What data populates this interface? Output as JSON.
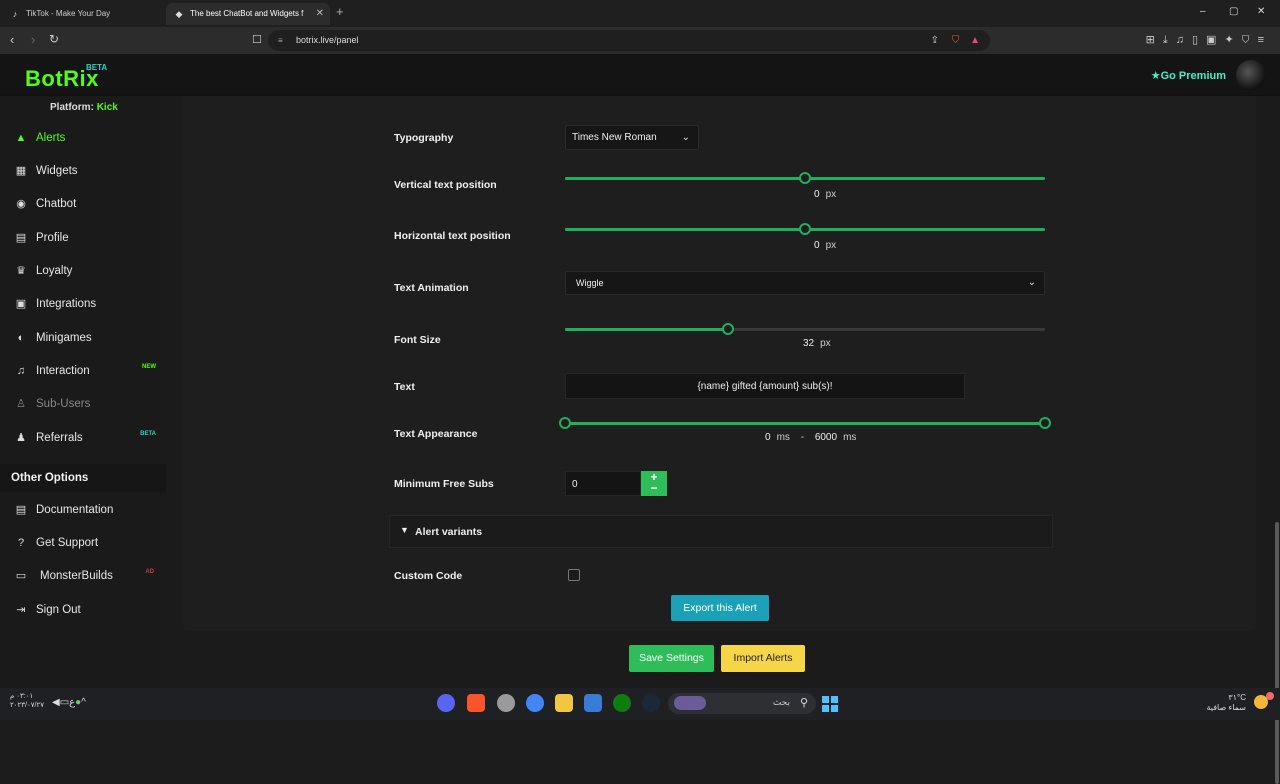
{
  "browser": {
    "tabs": [
      {
        "title": "TikTok - Make Your Day",
        "icon": "tiktok-icon"
      },
      {
        "title": "The best ChatBot and Widgets f",
        "icon": "botrix-icon"
      }
    ],
    "new_tab": "+",
    "url": "botrix.live/panel",
    "window_controls": {
      "minimize": "–",
      "maximize": "▢",
      "close": "✕"
    }
  },
  "header": {
    "logo": "BotRix",
    "beta": "BETA",
    "premium": "Go Premium"
  },
  "sidebar": {
    "platform_label": "Platform:",
    "platform_value": "Kick",
    "items": [
      {
        "label": "Alerts",
        "icon": "warning-icon",
        "glyph": "▲",
        "active": true
      },
      {
        "label": "Widgets",
        "icon": "widgets-icon",
        "glyph": "▦"
      },
      {
        "label": "Chatbot",
        "icon": "robot-icon",
        "glyph": "◉"
      },
      {
        "label": "Profile",
        "icon": "id-card-icon",
        "glyph": "▤"
      },
      {
        "label": "Loyalty",
        "icon": "trophy-icon",
        "glyph": "♛"
      },
      {
        "label": "Integrations",
        "icon": "integrations-icon",
        "glyph": "▣"
      },
      {
        "label": "Minigames",
        "icon": "gamepad-icon",
        "glyph": "◐"
      },
      {
        "label": "Interaction",
        "icon": "music-icon",
        "glyph": "♫",
        "badge": "NEW"
      },
      {
        "label": "Sub-Users",
        "icon": "sub-users-icon",
        "glyph": "♙"
      },
      {
        "label": "Referrals",
        "icon": "users-icon",
        "glyph": "♟",
        "badge": "BETA"
      }
    ],
    "other_title": "Other Options",
    "other_items": [
      {
        "label": "Documentation",
        "icon": "book-icon",
        "glyph": "▤"
      },
      {
        "label": "Get Support",
        "icon": "question-icon",
        "glyph": "?"
      },
      {
        "label": "MonsterBuilds",
        "icon": "laptop-icon",
        "glyph": "▭",
        "badge": "AD"
      },
      {
        "label": "Sign Out",
        "icon": "sign-out-icon",
        "glyph": "⇥"
      }
    ]
  },
  "form": {
    "typography": {
      "label": "Typography",
      "value": "Times New Roman"
    },
    "vertical": {
      "label": "Vertical text position",
      "value": "0",
      "unit": "px",
      "fraction": 0.5
    },
    "horizontal": {
      "label": "Horizontal text position",
      "value": "0",
      "unit": "px",
      "fraction": 0.5
    },
    "animation": {
      "label": "Text Animation",
      "value": "Wiggle"
    },
    "font_size": {
      "label": "Font Size",
      "value": "32",
      "unit": "px",
      "fraction": 0.34
    },
    "text": {
      "label": "Text",
      "value": "{name} gifted {amount} sub(s)!"
    },
    "appearance": {
      "label": "Text Appearance",
      "min": "0",
      "max": "6000",
      "separator": "-",
      "unit": "ms"
    },
    "min_free_subs": {
      "label": "Minimum Free Subs",
      "value": "0",
      "plus": "+",
      "minus": "−"
    },
    "alert_variants": "Alert variants",
    "custom_code": "Custom Code",
    "export": "Export this Alert"
  },
  "footer": {
    "save": "Save Settings",
    "import": "Import Alerts"
  },
  "taskbar": {
    "time": "٠٣:٠١ م",
    "date": "٢٠٢٣/٠٧/٢٧",
    "search": "بحث",
    "temperature": "٣١°C",
    "weather": "سماء صافية"
  },
  "colors": {
    "accent": "#53fc18",
    "slider": "#21b05a",
    "export": "#1ba1b7",
    "save": "#2ebd59",
    "import": "#f6d547"
  }
}
